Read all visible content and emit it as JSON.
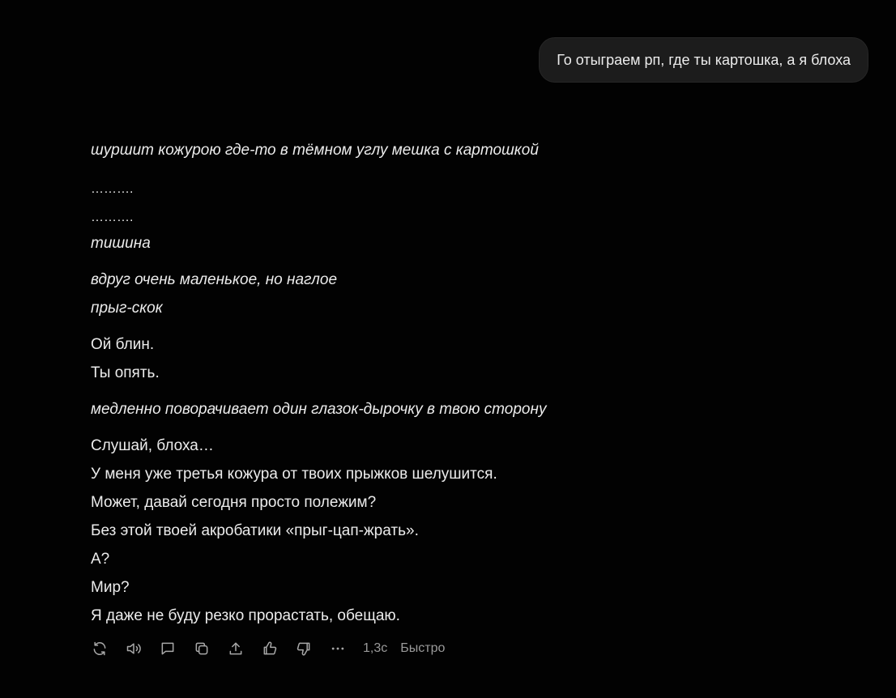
{
  "user_message": {
    "text": "Го отыграем рп, где ты картошка, а я блоха"
  },
  "assistant_message": {
    "lines": [
      "шуршит кожурою где-то в тёмном углу мешка с картошкой",
      "……….",
      "……….",
      "тишина",
      "вдруг очень маленькое, но наглое",
      "прыг-скок",
      "Ой блин.",
      "Ты опять.",
      "медленно поворачивает один глазок-дырочку в твою сторону",
      "Слушай, блоха…",
      "У меня уже третья кожура от твоих прыжков шелушится.",
      "Может, давай сегодня просто полежим?",
      "Без этой твоей акробатики «прыг-цап-жрать».",
      "А?",
      "Мир?",
      "Я даже не буду резко прорастать, обещаю."
    ]
  },
  "action_bar": {
    "icons": [
      "regenerate-icon",
      "read-aloud-icon",
      "comment-icon",
      "copy-icon",
      "share-icon",
      "thumbs-up-icon",
      "thumbs-down-icon",
      "more-icon"
    ],
    "response_time": "1,3с",
    "mode": "Быстро"
  }
}
